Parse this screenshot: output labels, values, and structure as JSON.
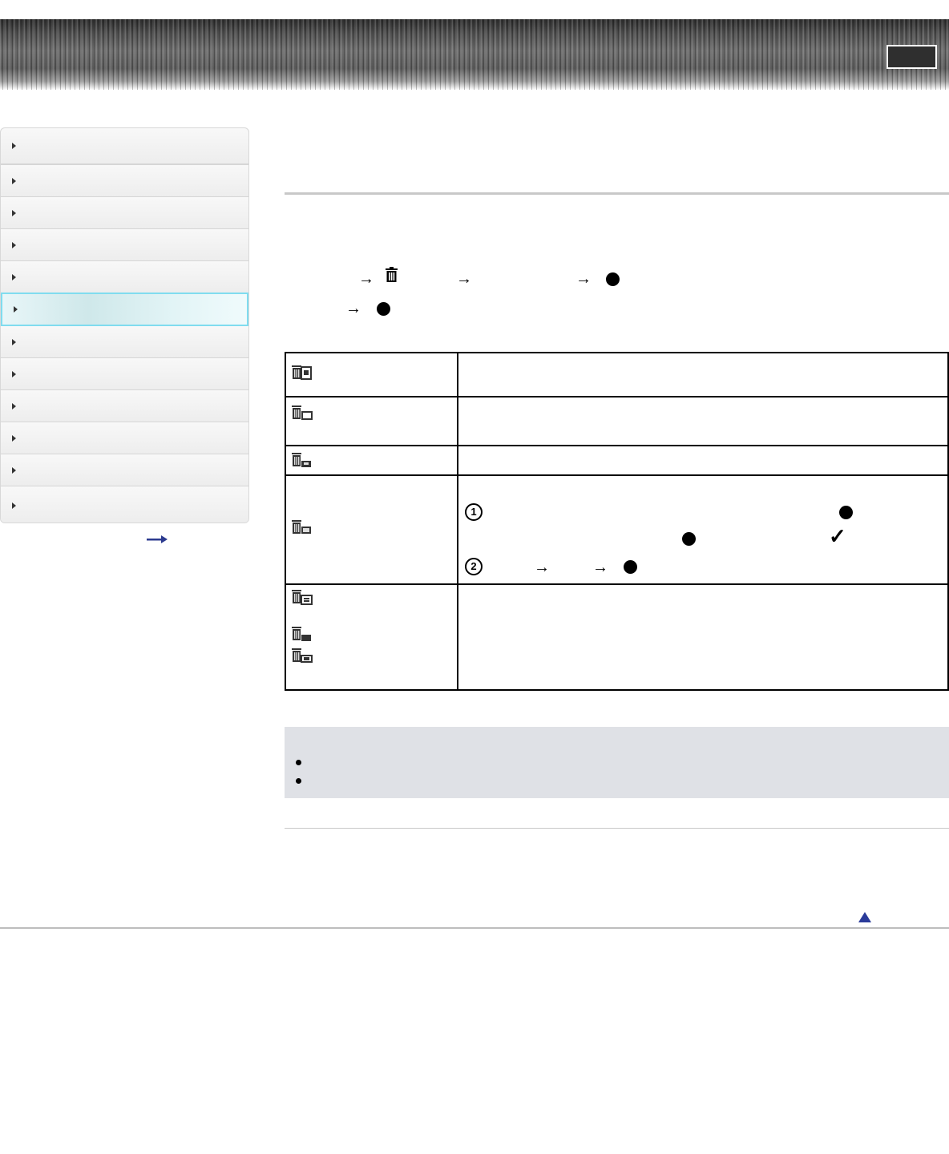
{
  "sidebar": {
    "items": [
      {
        "label": "",
        "active": false
      },
      {
        "label": "",
        "active": false
      },
      {
        "label": "",
        "active": false
      },
      {
        "label": "",
        "active": false
      },
      {
        "label": "",
        "active": false
      },
      {
        "label": "",
        "active": true
      },
      {
        "label": "",
        "active": false
      },
      {
        "label": "",
        "active": false
      },
      {
        "label": "",
        "active": false
      },
      {
        "label": "",
        "active": false
      },
      {
        "label": "",
        "active": false
      },
      {
        "label": "",
        "active": false
      }
    ]
  },
  "procedure": {
    "arrow": "→"
  },
  "table": {
    "row4": {
      "step1": "1",
      "step2": "2",
      "check": "✓"
    }
  },
  "icons": {
    "trash": "trash-icon",
    "back_to_top": "up-triangle-icon",
    "more_arrow": "right-arrow-icon"
  }
}
